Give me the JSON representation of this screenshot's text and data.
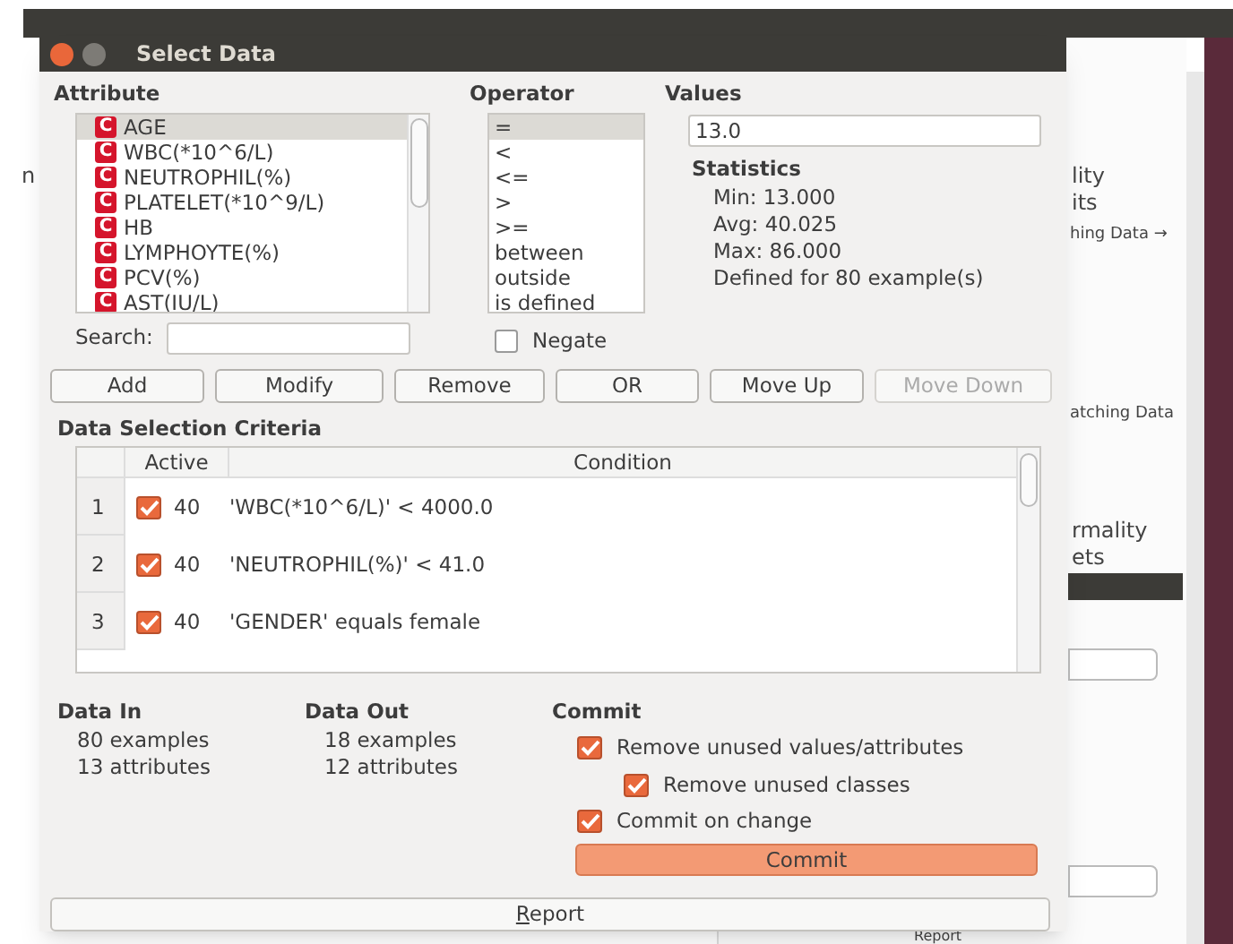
{
  "window": {
    "title": "Select Data"
  },
  "attribute": {
    "label": "Attribute",
    "search_label": "Search:",
    "items": [
      {
        "badge": "C",
        "name": "AGE",
        "selected": true
      },
      {
        "badge": "C",
        "name": "WBC(*10^6/L)",
        "selected": false
      },
      {
        "badge": "C",
        "name": "NEUTROPHIL(%)",
        "selected": false
      },
      {
        "badge": "C",
        "name": "PLATELET(*10^9/L)",
        "selected": false
      },
      {
        "badge": "C",
        "name": "HB",
        "selected": false
      },
      {
        "badge": "C",
        "name": "LYMPHOYTE(%)",
        "selected": false
      },
      {
        "badge": "C",
        "name": "PCV(%)",
        "selected": false
      },
      {
        "badge": "C",
        "name": "AST(IU/L)",
        "selected": false
      }
    ]
  },
  "operator": {
    "label": "Operator",
    "items": [
      {
        "label": "=",
        "selected": true
      },
      {
        "label": "<",
        "selected": false
      },
      {
        "label": "<=",
        "selected": false
      },
      {
        "label": ">",
        "selected": false
      },
      {
        "label": ">=",
        "selected": false
      },
      {
        "label": "between",
        "selected": false
      },
      {
        "label": "outside",
        "selected": false
      },
      {
        "label": "is defined",
        "selected": false
      }
    ],
    "negate": {
      "label": "Negate",
      "checked": false
    }
  },
  "values": {
    "label": "Values",
    "value": "13.0",
    "statistics_label": "Statistics",
    "lines": [
      "Min: 13.000",
      "Avg: 40.025",
      "Max: 86.000",
      "Defined for 80 example(s)"
    ]
  },
  "buttons": [
    {
      "label": "Add",
      "disabled": false
    },
    {
      "label": "Modify",
      "disabled": false
    },
    {
      "label": "Remove",
      "disabled": false
    },
    {
      "label": "OR",
      "disabled": false
    },
    {
      "label": "Move Up",
      "disabled": false
    },
    {
      "label": "Move Down",
      "disabled": true
    }
  ],
  "criteria": {
    "label": "Data Selection Criteria",
    "columns": [
      "Active",
      "Condition"
    ],
    "rows": [
      {
        "index": "1",
        "active": true,
        "count": "40",
        "condition": "'WBC(*10^6/L)' < 4000.0"
      },
      {
        "index": "2",
        "active": true,
        "count": "40",
        "condition": "'NEUTROPHIL(%)' < 41.0"
      },
      {
        "index": "3",
        "active": true,
        "count": "40",
        "condition": "'GENDER' equals female"
      }
    ]
  },
  "data_in": {
    "label": "Data In",
    "lines": [
      "80 examples",
      "13 attributes"
    ]
  },
  "data_out": {
    "label": "Data Out",
    "lines": [
      "18 examples",
      "12 attributes"
    ]
  },
  "commit": {
    "label": "Commit",
    "options": [
      {
        "label": "Remove unused values/attributes",
        "checked": true,
        "children": [
          {
            "label": "Remove unused classes",
            "checked": true
          }
        ]
      },
      {
        "label": "Commit on change",
        "checked": true
      }
    ],
    "button": "Commit"
  },
  "report_button": "Report",
  "background_window": {
    "texts": [
      "n",
      "lity",
      "its",
      "hing Data →",
      "atching Data",
      "rmality",
      "ets",
      "Report"
    ]
  }
}
